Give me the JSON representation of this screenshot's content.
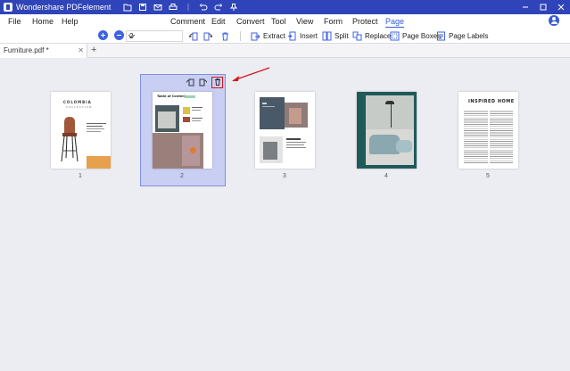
{
  "app": {
    "title": "Wondershare PDFelement"
  },
  "menu": {
    "left": [
      "File",
      "Home",
      "Help"
    ],
    "center": [
      "Comment",
      "Edit",
      "Convert",
      "Tool",
      "View",
      "Form",
      "Protect",
      "Page"
    ],
    "active": "Page"
  },
  "toolbar": {
    "page_value": "2",
    "tools": [
      "Extract",
      "Insert",
      "Split",
      "Replace",
      "Page Boxes",
      "Page Labels"
    ]
  },
  "tabs": [
    {
      "label": "Furniture.pdf *"
    }
  ],
  "pages": [
    {
      "number": "1",
      "heading": "COLOMBIA",
      "sub": "COLLECTION",
      "selected": false
    },
    {
      "number": "2",
      "heading": "Table of Contents",
      "selected": true
    },
    {
      "number": "3",
      "selected": false
    },
    {
      "number": "4",
      "selected": false
    },
    {
      "number": "5",
      "heading": "INSPIRED HOME",
      "selected": false
    }
  ],
  "colors": {
    "titlebar": "#2f44b8",
    "accent": "#2f5be0",
    "selection": "#c8cff3",
    "delete_highlight": "#d4161c"
  },
  "icons": [
    "logo-icon",
    "folder-icon",
    "save-icon",
    "email-icon",
    "print-icon",
    "undo-icon",
    "redo-icon",
    "pin-icon",
    "minimize-icon",
    "maximize-icon",
    "close-icon",
    "zoom-in-icon",
    "zoom-out-icon",
    "rotate-icon",
    "delete-icon"
  ]
}
